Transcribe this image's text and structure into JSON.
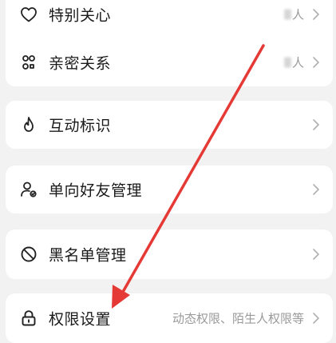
{
  "groups": [
    {
      "items": [
        {
          "label": "特别关心",
          "value": "人",
          "value_obscured": true,
          "icon": "heart-icon"
        },
        {
          "label": "亲密关系",
          "value": "人",
          "value_obscured": true,
          "icon": "people-icon"
        }
      ]
    },
    {
      "items": [
        {
          "label": "互动标识",
          "icon": "fire-icon"
        }
      ]
    },
    {
      "items": [
        {
          "label": "单向好友管理",
          "icon": "user-settings-icon"
        }
      ]
    },
    {
      "items": [
        {
          "label": "黑名单管理",
          "icon": "block-icon"
        }
      ]
    },
    {
      "items": [
        {
          "label": "权限设置",
          "value": "动态权限、陌生人权限等",
          "icon": "lock-icon"
        }
      ]
    }
  ],
  "annotation": {
    "type": "red-arrow",
    "color": "#e53935",
    "points_to": "权限设置"
  },
  "colors": {
    "background": "#f2f2f2",
    "card": "#ffffff",
    "text": "#1a1a1a",
    "secondary": "#9a9a9a"
  }
}
